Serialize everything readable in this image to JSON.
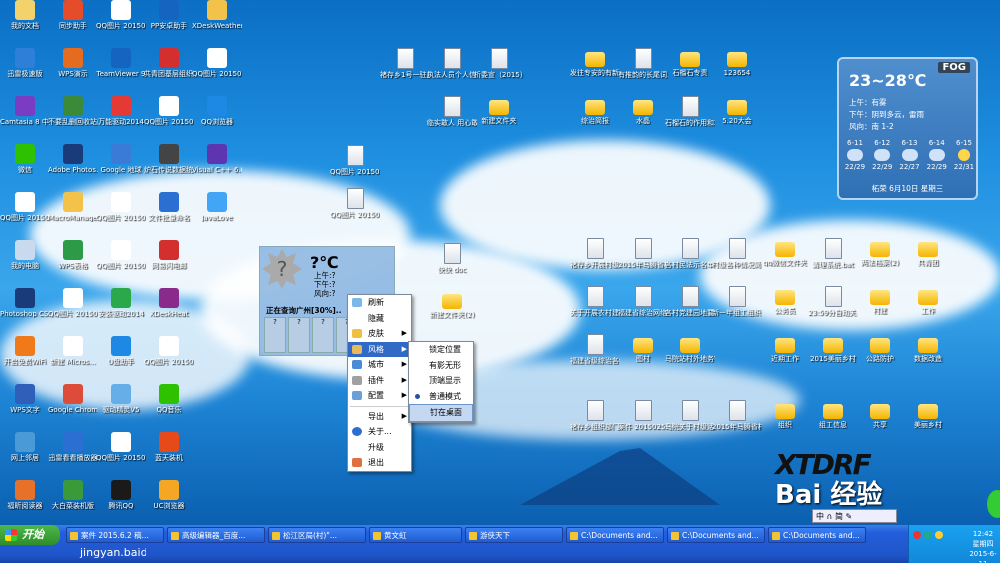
{
  "desktop_icons_left": [
    {
      "label": "我的文档",
      "color": "#f2d36b"
    },
    {
      "label": "迅雷极速版",
      "color": "#2e7fd8"
    },
    {
      "label": "Camtasia 8 中文绿色",
      "color": "#7a3cc2"
    },
    {
      "label": "微信",
      "color": "#2dc100"
    },
    {
      "label": "QQ图片 201506111...",
      "color": "#ffffff"
    },
    {
      "label": "我的电脑",
      "color": "#c9d9ee"
    },
    {
      "label": "Photoshop CS3",
      "color": "#1a3b7a"
    },
    {
      "label": "开启免费WiFi",
      "color": "#f07a1a"
    },
    {
      "label": "WPS文字",
      "color": "#2f5fb8"
    },
    {
      "label": "网上邻居",
      "color": "#4a9ad8"
    },
    {
      "label": "福昕阅读器",
      "color": "#e8712a"
    },
    {
      "label": "同步助手",
      "color": "#e54d2a"
    },
    {
      "label": "WPS演示",
      "color": "#e56b1f"
    },
    {
      "label": "不要乱删回收站的东西",
      "color": "#3a8a3a"
    },
    {
      "label": "Adobe Photos...",
      "color": "#1a3b7a"
    },
    {
      "label": "MacroManager",
      "color": "#f2c24a"
    },
    {
      "label": "WPS表格",
      "color": "#2c9a46"
    },
    {
      "label": "QQ图片 201506111...",
      "color": "#ffffff"
    },
    {
      "label": "新建 Micros...",
      "color": "#ffffff"
    },
    {
      "label": "Google Chrome",
      "color": "#dd4b39"
    },
    {
      "label": "迅雷看看播放器",
      "color": "#2a6fd1"
    },
    {
      "label": "大白菜装机版",
      "color": "#3a9a3a"
    },
    {
      "label": "QQ图片 201506111...",
      "color": "#ffffff"
    },
    {
      "label": "TeamViewer 9",
      "color": "#1565c0"
    },
    {
      "label": "万能驱动2014",
      "color": "#e53935"
    },
    {
      "label": "Google 地球",
      "color": "#3b7bd8"
    },
    {
      "label": "QQ图片 201506111...",
      "color": "#ffffff"
    },
    {
      "label": "QQ图片 201506111...",
      "color": "#ffffff"
    },
    {
      "label": "安装驱动2014",
      "color": "#2ba84a"
    },
    {
      "label": "U盘助手",
      "color": "#1e88e5"
    },
    {
      "label": "驱动精灵V5",
      "color": "#66aee8"
    },
    {
      "label": "QQ图片 201506111...",
      "color": "#ffffff"
    },
    {
      "label": "腾讯QQ",
      "color": "#1a1a1a"
    },
    {
      "label": "PP安卓助手",
      "color": "#1565c0"
    },
    {
      "label": "共青团基层组织数据平",
      "color": "#d32f2f"
    },
    {
      "label": "QQ图片 201506111...",
      "color": "#ffffff"
    },
    {
      "label": "炉石传说数据统计",
      "color": "#444444"
    },
    {
      "label": "文件批量命名",
      "color": "#2a6fd1"
    },
    {
      "label": "网易闪电邮",
      "color": "#d32f2f"
    },
    {
      "label": "XDeskHeat",
      "color": "#8a2a8a"
    },
    {
      "label": "QQ图片 201506111...",
      "color": "#ffffff"
    },
    {
      "label": "QQ音乐",
      "color": "#2dc100"
    },
    {
      "label": "蓝天装机",
      "color": "#e64a19"
    },
    {
      "label": "UC浏览器",
      "color": "#f5a623"
    },
    {
      "label": "XDeskWeather",
      "color": "#f2c24a"
    },
    {
      "label": "QQ图片 201506111...",
      "color": "#ffffff"
    },
    {
      "label": "QQ浏览器",
      "color": "#1e88e5"
    },
    {
      "label": "Visual C++ 6.0",
      "color": "#5e35b1"
    },
    {
      "label": "JavaLove",
      "color": "#42a5f5"
    }
  ],
  "desktop_icons_middle": [
    {
      "label": "QQ图片 201506111...",
      "type": "doc"
    },
    {
      "label": "QQ图片 201506111...",
      "type": "doc"
    },
    {
      "label": "褚存乡1号一驻点村汇总",
      "type": "doc"
    },
    {
      "label": "执法人员个人信息登记...",
      "type": "doc"
    },
    {
      "label": "析委宣（2015）16关于...",
      "type": "doc"
    },
    {
      "label": "发往专安的有新闻报道",
      "type": "folder"
    },
    {
      "label": "有推韵的长尾词.txt",
      "type": "doc"
    },
    {
      "label": "石榴石专责",
      "type": "folder"
    },
    {
      "label": "123654",
      "type": "folder"
    },
    {
      "label": "临实敢人 用心敢事",
      "type": "doc"
    },
    {
      "label": "新建文件夹",
      "type": "folder"
    },
    {
      "label": "综治简报",
      "type": "folder"
    },
    {
      "label": "水晶",
      "type": "folder"
    },
    {
      "label": "石榴石的作用和功效",
      "type": "doc"
    },
    {
      "label": "5.20大会",
      "type": "folder"
    },
    {
      "label": "快快 doc",
      "type": "doc"
    },
    {
      "label": "新建文件夹(2)",
      "type": "folder"
    }
  ],
  "desktop_icons_right": [
    "褚存乡开展村级党组织..",
    "2015年马腾省村\"两委\"..",
    "各村民法示名单.xls",
    "村级各种情况简介.doc",
    "qq微信文件夹",
    "清理系统.bat",
    "两法档案(2)",
    "共青团",
    "关于开展农村建设调查..",
    "福建省综治网络员信息库",
    "各村党建园地要求规定.xls",
    "新一年组工组织说明.txt",
    "公务员",
    "23:59分自动关机.bat",
    "村建",
    "工作",
    "福建省级综治各级工作报告",
    "图村",
    "马院站村外地务镇",
    "近期工作",
    "2015美丽乡村",
    "公路防护",
    "数据改造",
    "褚存乡组织部门一览",
    "案件 20150251",
    "马院关于村级活动图片",
    "2015年马腾省村主任大报告",
    "组织",
    "组工信息",
    "共享",
    "美丽乡村"
  ],
  "weather": {
    "badge": "FOG",
    "temp": "23~28℃",
    "am": "上午：有雾",
    "pm": "下午：阴到多云，雷雨",
    "wind": "风向：南 1-2",
    "days": [
      {
        "date": "6-11",
        "range": "22/29"
      },
      {
        "date": "6-12",
        "range": "22/29"
      },
      {
        "date": "6-13",
        "range": "22/27"
      },
      {
        "date": "6-14",
        "range": "22/29"
      },
      {
        "date": "6-15",
        "range": "22/31"
      }
    ],
    "footer": "柘荣   6月10日   星期三"
  },
  "mini_weather": {
    "temp": "?℃",
    "am": "上午:?",
    "pm": "下午:?",
    "wind": "风向:?",
    "status": "正在查询广州[30%]..",
    "cells": [
      "?",
      "?",
      "?",
      "?"
    ]
  },
  "context_menu": [
    "刷新",
    "隐藏",
    "皮肤",
    "风格",
    "城市",
    "插件",
    "配置",
    "导出",
    "关于...",
    "升级",
    "退出"
  ],
  "submenu": [
    "锁定位置",
    "有影无形",
    "顶端显示",
    "普通模式",
    "钉在桌面"
  ],
  "watermark": {
    "brand": "Bai 经验",
    "url": "jingyan.baidu.com"
  },
  "taskbar": {
    "start": "开始",
    "tasks": [
      "案件 2015.6.2 稿...",
      "高级编辑器_百度...",
      "松江区局(村)\"...",
      "黄文虹",
      "游侠天下",
      "C:\\Documents and...",
      "C:\\Documents and...",
      "C:\\Documents and..."
    ],
    "time": "12:42",
    "weekday": "星期四",
    "date": "2015-6-11"
  },
  "ime": "中 ∩ 简 ✎"
}
